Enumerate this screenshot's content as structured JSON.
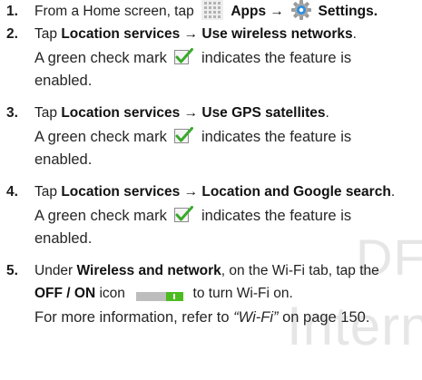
{
  "steps": [
    {
      "num": "1.",
      "parts": [
        "From a Home screen, tap",
        "Apps →",
        "Settings."
      ],
      "icons": [
        "apps-grid-icon",
        "settings-gear-icon"
      ]
    },
    {
      "num": "2.",
      "prefix": "Tap",
      "bold": "Location services → Use wireless networks",
      "suffix": ".",
      "desc_before": "A green check mark",
      "desc_after": "indicates the feature is",
      "desc_line2": "enabled."
    },
    {
      "num": "3.",
      "prefix": "Tap",
      "bold": "Location services → Use GPS satellites",
      "suffix": ".",
      "desc_before": "A green check mark",
      "desc_after": "indicates the feature is",
      "desc_line2": "enabled."
    },
    {
      "num": "4.",
      "prefix": "Tap",
      "bold": "Location services → Location and Google search",
      "suffix": ".",
      "desc_before": "A green check mark",
      "desc_after": "indicates the feature is",
      "desc_line2": "enabled."
    },
    {
      "num": "5.",
      "line1_prefix": "Under",
      "line1_bold": "Wireless and network",
      "line1_suffix": ", on the Wi-Fi tab, tap the",
      "line2_bold": "OFF / ON",
      "line2_mid": "icon",
      "line2_suffix": "to turn Wi-Fi on.",
      "more_prefix": "For more information, refer to",
      "more_ref": "“Wi-Fi”",
      "more_suffix": "on page 150."
    }
  ],
  "watermark": {
    "line1": "DF",
    "line2": "Internal"
  },
  "colors": {
    "check_green": "#3aa82c",
    "toggle_gray": "#bdbdbd",
    "toggle_green": "#4cbb1f"
  }
}
